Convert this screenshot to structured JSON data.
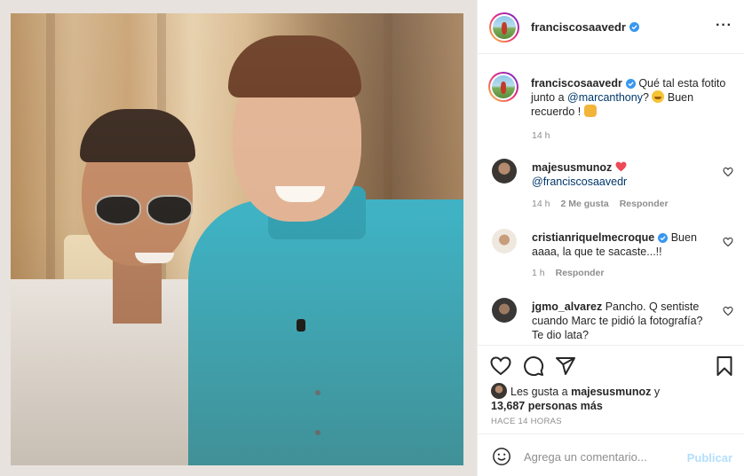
{
  "post": {
    "author": "francisco.saavedr",
    "author_display": "franciscosaavedr"
  },
  "caption": {
    "username": "franciscosaavedr",
    "text_before": " Qué tal esta fotito junto a ",
    "mention": "@marcanthony",
    "text_middle": "? ",
    "text_after": " Buen recuerdo ! ",
    "time": "14 h"
  },
  "comments": [
    {
      "username": "majesusmunoz",
      "mention": "@franciscosaavedr",
      "time": "14 h",
      "likes": "2 Me gusta",
      "reply": "Responder"
    },
    {
      "username": "cristianriquelmecroque",
      "text": " Buen aaaa, la que te sacaste...!!",
      "time": "1 h",
      "reply": "Responder"
    },
    {
      "username": "jgmo_alvarez",
      "text": " Pancho. Q sentiste cuando Marc te pidió la fotografía? Te dio lata?"
    }
  ],
  "likes": {
    "prefix": "Les gusta a ",
    "user": "majesusmunoz",
    "middle": " y",
    "count": "13,687 personas más"
  },
  "posted_ago": "HACE 14 HORAS",
  "add_comment": {
    "placeholder": "Agrega un comentario...",
    "publish": "Publicar"
  },
  "colors": {
    "verified": "#3897f0",
    "heart": "#ed4956",
    "mention": "#00376b",
    "publish_disabled": "#b2dffc"
  },
  "icons": [
    "verified-badge-icon",
    "more-options-icon",
    "heart-icon",
    "comment-icon",
    "share-icon",
    "bookmark-icon",
    "emoji-icon"
  ]
}
